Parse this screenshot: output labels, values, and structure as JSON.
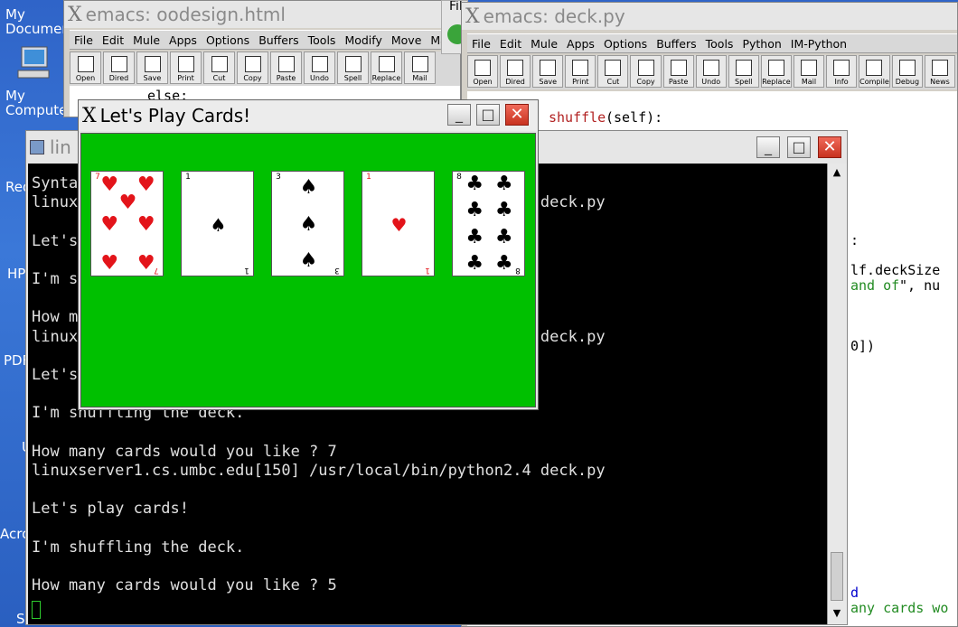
{
  "desktop": {
    "icons": [
      {
        "label": "My Documen"
      },
      {
        "label": "My Compute"
      },
      {
        "label": "Red"
      },
      {
        "label": "HP"
      },
      {
        "label": "PDF"
      },
      {
        "label": "U"
      },
      {
        "label": "Acro"
      },
      {
        "label": "Ser"
      }
    ]
  },
  "emacs_oodesign": {
    "title": "emacs: oodesign.html",
    "menu": [
      "File",
      "Edit",
      "Mule",
      "Apps",
      "Options",
      "Buffers",
      "Tools",
      "Modify",
      "Move",
      "Marku"
    ],
    "toolbar": [
      "Open",
      "Dired",
      "Save",
      "Print",
      "Cut",
      "Copy",
      "Paste",
      "Undo",
      "Spell",
      "Replace",
      "Mail"
    ],
    "code_visible": "else:"
  },
  "emacs_deck": {
    "title": "emacs: deck.py",
    "menu": [
      "File",
      "Edit",
      "Mule",
      "Apps",
      "Options",
      "Buffers",
      "Tools",
      "Python",
      "IM-Python"
    ],
    "toolbar": [
      "Open",
      "Dired",
      "Save",
      "Print",
      "Cut",
      "Copy",
      "Paste",
      "Undo",
      "Spell",
      "Replace",
      "Mail",
      "Info",
      "Compile",
      "Debug",
      "News"
    ],
    "code_lines": [
      {
        "text": "shuffle",
        "color": "#b22222"
      },
      {
        "text": "(self):",
        "color": "#000000"
      },
      {
        "text": ":",
        "color": "#000000"
      },
      {
        "text": "lf.deckSize",
        "color": "#000000"
      },
      {
        "text": "and of",
        "color": "#228b22"
      },
      {
        "text": "\", nu",
        "color": "#000000"
      },
      {
        "text": "0])",
        "color": "#000000"
      },
      {
        "text": "d",
        "color": "#0000cd"
      },
      {
        "text": "any cards wo",
        "color": "#228b22"
      }
    ]
  },
  "terminal": {
    "title": "lin",
    "lines": [
      "Synta",
      "linux                                              2.4 deck.py",
      "",
      "Let's",
      "",
      "I'm s",
      "",
      "How m",
      "linux                                              2.4 deck.py",
      "",
      "Let's",
      "",
      "I'm shuffling the deck.",
      "",
      "How many cards would you like ? 7",
      "linuxserver1.cs.umbc.edu[150] /usr/local/bin/python2.4 deck.py",
      "",
      "Let's play cards!",
      "",
      "I'm shuffling the deck.",
      "",
      "How many cards would you like ? 5"
    ]
  },
  "cards_window": {
    "title": "Let's Play Cards!",
    "background": "#00c000",
    "cards": [
      {
        "rank": "7",
        "suit": "hearts",
        "symbol": "♥",
        "color": "#e3141a"
      },
      {
        "rank": "1",
        "suit": "spades",
        "symbol": "♠",
        "color": "#000000"
      },
      {
        "rank": "3",
        "suit": "spades",
        "symbol": "♠",
        "color": "#000000"
      },
      {
        "rank": "1",
        "suit": "hearts",
        "symbol": "♥",
        "color": "#e3141a"
      },
      {
        "rank": "8",
        "suit": "clubs",
        "symbol": "♣",
        "color": "#000000"
      }
    ]
  },
  "misc": {
    "top_right_fragment": "Fil"
  }
}
